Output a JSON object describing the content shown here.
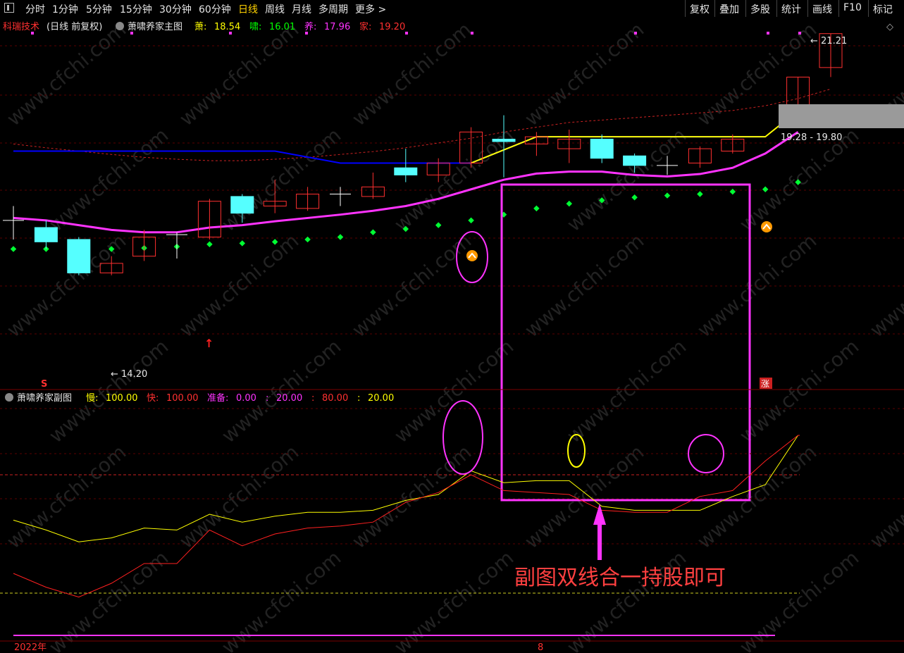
{
  "toolbar": {
    "periods": [
      "分时",
      "1分钟",
      "5分钟",
      "15分钟",
      "30分钟",
      "60分钟",
      "日线",
      "周线",
      "月线",
      "多周期",
      "更多 >"
    ],
    "active_period": "日线",
    "right_buttons": [
      "复权",
      "叠加",
      "多股",
      "统计",
      "画线",
      "F10",
      "标记"
    ]
  },
  "main_header": {
    "stock": "科瑞技术",
    "mode": "(日线 前复权)",
    "indicator": "萧啸养家主图",
    "values": [
      {
        "label": "萧:",
        "value": "18.54",
        "color": "#ffff00"
      },
      {
        "label": "啸:",
        "value": "16.01",
        "color": "#00ff00"
      },
      {
        "label": "养:",
        "value": "17.96",
        "color": "#ff33ff"
      },
      {
        "label": "家:",
        "value": "19.20",
        "color": "#ff3030"
      }
    ]
  },
  "sub_header": {
    "indicator": "萧啸养家副图",
    "values": [
      {
        "label": "慢:",
        "value": "100.00",
        "color": "#ffff00"
      },
      {
        "label": "快:",
        "value": "100.00",
        "color": "#ff3030"
      },
      {
        "label": "准备:",
        "value": "0.00",
        "color": "#ff33ff"
      },
      {
        "label": ":",
        "value": "20.00",
        "color": "#ff33ff"
      },
      {
        "label": ":",
        "value": "80.00",
        "color": "#ff3030"
      },
      {
        "label": ":",
        "value": "20.00",
        "color": "#ffff00"
      }
    ]
  },
  "annotations": {
    "price_low": "14.20",
    "price_high": "21.21",
    "price_range": "19.28 - 19.80",
    "signal_s": "S",
    "signal_zhang": "涨",
    "callout": "副图双线合一持股即可",
    "x_start": "2022年",
    "x_mid": "8"
  },
  "colors": {
    "up": "#ff3030",
    "down": "#55ffff",
    "ma_yellow": "#ffff00",
    "ma_blue": "#0000ff",
    "ma_magenta": "#ff33ff",
    "dots": "#00ff33",
    "box": "#ff33ff",
    "dash_red": "#cc2222"
  },
  "chart_data": [
    {
      "type": "candlestick",
      "title": "萧啸养家主图",
      "candles": [
        {
          "o": 17.3,
          "c": 17.3,
          "h": 17.6,
          "l": 16.9
        },
        {
          "o": 17.15,
          "c": 16.85,
          "h": 17.3,
          "l": 16.7
        },
        {
          "o": 16.9,
          "c": 16.2,
          "h": 16.95,
          "l": 16.15
        },
        {
          "o": 16.2,
          "c": 16.4,
          "h": 16.55,
          "l": 16.15
        },
        {
          "o": 16.55,
          "c": 16.95,
          "h": 17.1,
          "l": 16.45
        },
        {
          "o": 17.0,
          "c": 17.0,
          "h": 17.05,
          "l": 16.5
        },
        {
          "o": 16.95,
          "c": 17.7,
          "h": 17.75,
          "l": 16.9
        },
        {
          "o": 17.8,
          "c": 17.45,
          "h": 17.85,
          "l": 17.25
        },
        {
          "o": 17.6,
          "c": 17.7,
          "h": 18.15,
          "l": 17.45
        },
        {
          "o": 17.55,
          "c": 17.85,
          "h": 18.0,
          "l": 17.5
        },
        {
          "o": 17.85,
          "c": 17.85,
          "h": 18.0,
          "l": 17.6
        },
        {
          "o": 17.8,
          "c": 18.0,
          "h": 18.3,
          "l": 17.75
        },
        {
          "o": 18.4,
          "c": 18.25,
          "h": 18.8,
          "l": 18.1
        },
        {
          "o": 18.25,
          "c": 18.5,
          "h": 18.6,
          "l": 18.1
        },
        {
          "o": 18.5,
          "c": 19.15,
          "h": 19.25,
          "l": 18.4
        },
        {
          "o": 19.0,
          "c": 18.95,
          "h": 19.5,
          "l": 18.2
        },
        {
          "o": 18.9,
          "c": 19.05,
          "h": 19.15,
          "l": 18.65
        },
        {
          "o": 18.8,
          "c": 19.0,
          "h": 19.2,
          "l": 18.5
        },
        {
          "o": 19.0,
          "c": 18.6,
          "h": 19.1,
          "l": 18.5
        },
        {
          "o": 18.65,
          "c": 18.45,
          "h": 18.7,
          "l": 18.3
        },
        {
          "o": 18.45,
          "c": 18.45,
          "h": 18.65,
          "l": 18.25
        },
        {
          "o": 18.5,
          "c": 18.8,
          "h": 18.85,
          "l": 18.4
        },
        {
          "o": 18.75,
          "c": 19.0,
          "h": 19.1,
          "l": 18.7
        },
        null,
        {
          "o": 19.3,
          "c": 20.3,
          "h": 20.3,
          "l": 19.3
        },
        {
          "o": 20.5,
          "c": 21.21,
          "h": 21.21,
          "l": 20.3
        }
      ],
      "ma_magenta": [
        17.35,
        17.3,
        17.2,
        17.1,
        17.05,
        17.05,
        17.15,
        17.2,
        17.28,
        17.35,
        17.42,
        17.5,
        17.6,
        17.75,
        17.95,
        18.15,
        18.28,
        18.32,
        18.32,
        18.25,
        18.22,
        18.27,
        18.4,
        18.7,
        19.15
      ],
      "ma_blue": {
        "segments": [
          [
            0,
            18.75
          ],
          [
            8,
            18.75
          ],
          [
            10,
            18.5
          ],
          [
            14,
            18.5
          ],
          [
            16,
            19.05
          ],
          [
            23,
            19.05
          ]
        ]
      },
      "ma_yellow": [
        [
          14,
          18.5
        ],
        [
          16,
          19.05
        ],
        [
          17,
          19.05
        ],
        [
          23,
          19.05
        ],
        [
          24,
          19.6
        ]
      ],
      "dots": [
        16.7,
        16.7,
        16.7,
        16.7,
        16.72,
        16.75,
        16.8,
        16.82,
        16.85,
        16.9,
        16.95,
        17.05,
        17.12,
        17.2,
        17.3,
        17.42,
        17.55,
        17.65,
        17.72,
        17.78,
        17.82,
        17.85,
        17.9,
        17.95,
        18.1
      ],
      "dashed_red": [
        18.9,
        18.82,
        18.75,
        18.68,
        18.62,
        18.58,
        18.55,
        18.55,
        18.58,
        18.62,
        18.68,
        18.74,
        18.82,
        18.92,
        19.02,
        19.15,
        19.25,
        19.35,
        19.4,
        19.45,
        19.5,
        19.55,
        19.6,
        19.7,
        19.85,
        20.05
      ]
    },
    {
      "type": "line",
      "title": "萧啸养家副图",
      "ylim": [
        0,
        100
      ],
      "series": [
        {
          "name": "慢",
          "values": [
            57,
            52,
            46,
            48,
            53,
            52,
            60,
            56,
            59,
            61,
            61,
            62,
            67,
            70,
            82,
            76,
            77,
            77,
            64,
            62,
            62,
            62,
            69,
            75,
            100
          ]
        },
        {
          "name": "快",
          "values": [
            30,
            23,
            18,
            25,
            35,
            35,
            52,
            44,
            50,
            53,
            54,
            56,
            66,
            71,
            80,
            72,
            71,
            70,
            62,
            61,
            61,
            69,
            72,
            87,
            100
          ]
        }
      ],
      "levels": [
        80,
        20
      ]
    }
  ]
}
